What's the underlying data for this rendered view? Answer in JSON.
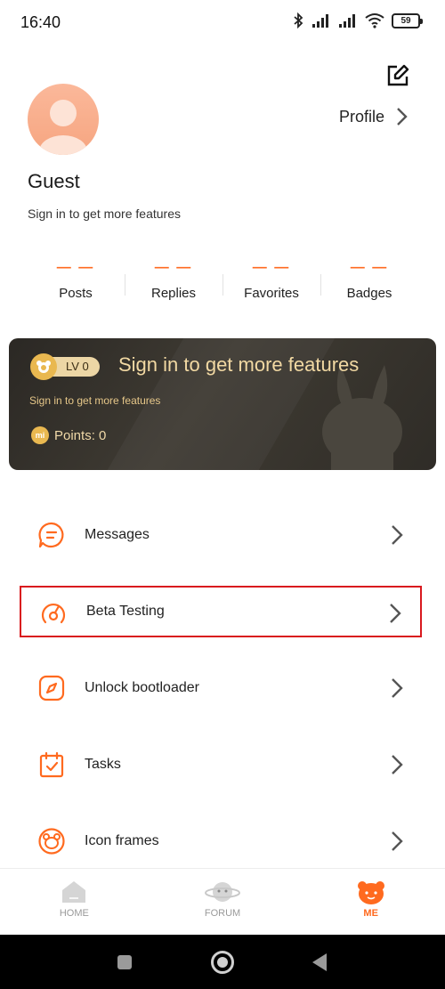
{
  "status_bar": {
    "time": "16:40",
    "battery_level": "59",
    "icons": [
      "bluetooth-icon",
      "signal-icon",
      "signal-icon",
      "wifi-icon",
      "battery-icon"
    ]
  },
  "header": {
    "profile_label": "Profile",
    "username": "Guest",
    "subtitle": "Sign in to get more features"
  },
  "stats": [
    {
      "value": "— —",
      "label": "Posts"
    },
    {
      "value": "— —",
      "label": "Replies"
    },
    {
      "value": "— —",
      "label": "Favorites"
    },
    {
      "value": "— —",
      "label": "Badges"
    }
  ],
  "level_card": {
    "level": "LV 0",
    "title": "Sign in to get more features",
    "subtitle": "Sign in to get more features",
    "coin_mark": "mi",
    "points": "Points: 0"
  },
  "menu": [
    {
      "label": "Messages",
      "icon": "message-icon"
    },
    {
      "label": "Beta Testing",
      "icon": "speedometer-icon"
    },
    {
      "label": "Unlock bootloader",
      "icon": "compass-icon"
    },
    {
      "label": "Tasks",
      "icon": "calendar-check-icon"
    },
    {
      "label": "Icon frames",
      "icon": "bear-frame-icon"
    }
  ],
  "bottom_nav": [
    {
      "label": "HOME",
      "active": false
    },
    {
      "label": "FORUM",
      "active": false
    },
    {
      "label": "ME",
      "active": true
    }
  ],
  "colors": {
    "accent": "#ff6a1f",
    "highlight_border": "#d9191e",
    "card_gold": "#f2d9a3"
  }
}
